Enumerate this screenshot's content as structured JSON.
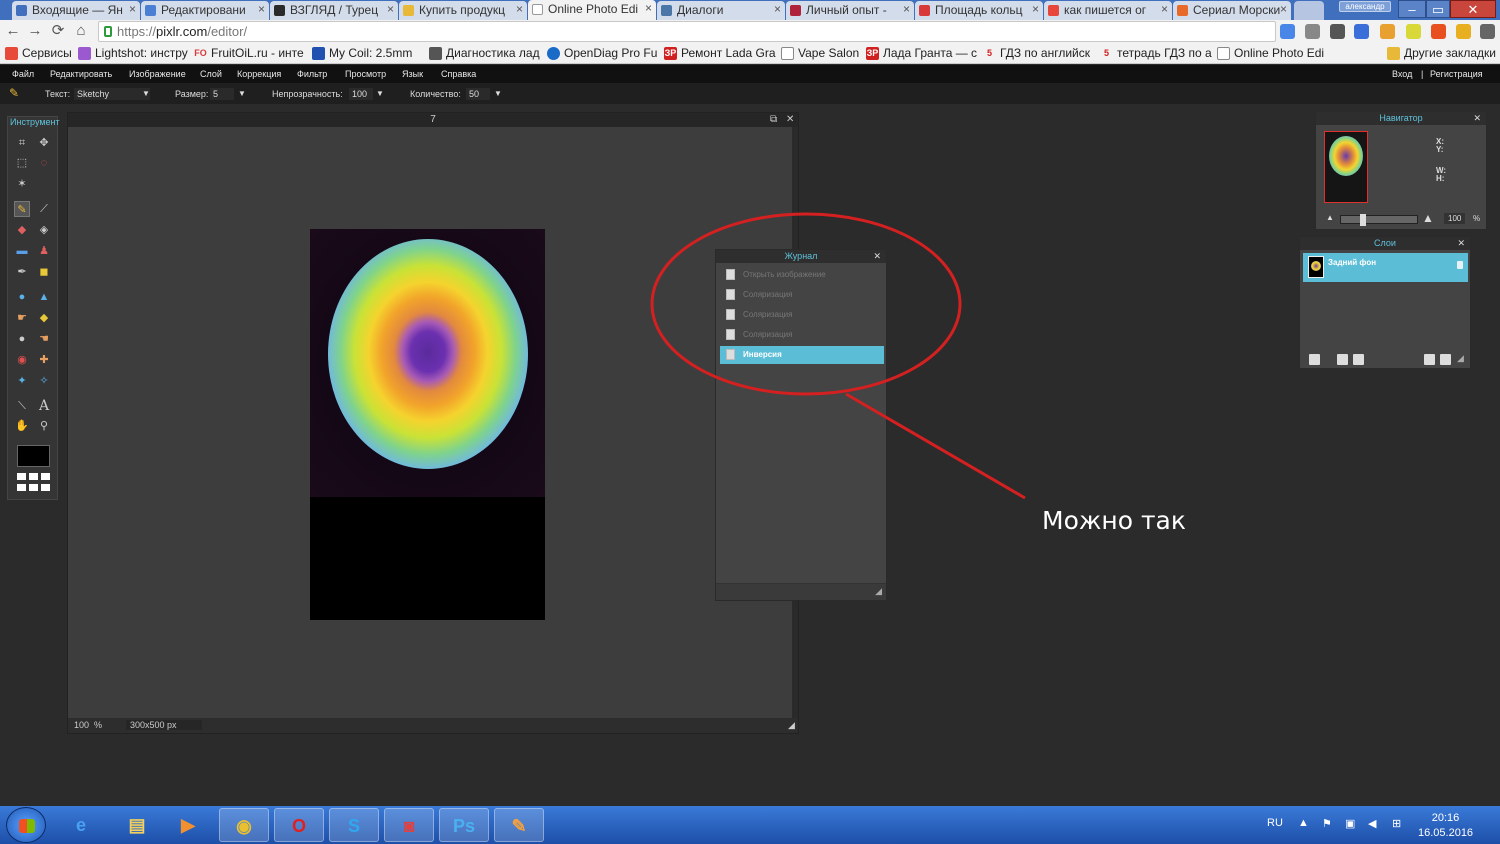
{
  "browser": {
    "tabs": [
      {
        "label": "Входящие — Ян",
        "color": "#3f6fbd"
      },
      {
        "label": "Редактировани",
        "color": "#4a7fd4"
      },
      {
        "label": "ВЗГЛЯД / Турец",
        "color": "#2a2a2a"
      },
      {
        "label": "Купить продукц",
        "color": "#e8b838"
      },
      {
        "label": "Online Photo Edi",
        "color": "#ffffff"
      },
      {
        "label": "Диалоги",
        "color": "#4a76a8"
      },
      {
        "label": "Личный опыт -",
        "color": "#b0223a"
      },
      {
        "label": "Площадь кольц",
        "color": "#d83a3a"
      },
      {
        "label": "как пишется ог",
        "color": "#e8463a"
      },
      {
        "label": "Сериал Морски",
        "color": "#e86a2a"
      }
    ],
    "active_tab": 4,
    "user": "александр",
    "url_prefix": "https://",
    "url_host": "pixlr.com",
    "url_path": "/editor/",
    "bookmarks": [
      {
        "label": "Сервисы",
        "icon": "apps-icon",
        "color": "#e84a3a"
      },
      {
        "label": "Lightshot: инстру",
        "icon": "feather-icon",
        "color": "#9b59d0"
      },
      {
        "label": "FruitOiL.ru - инте",
        "icon": "fo-icon",
        "color": "#d83a3a",
        "glyph": "FO"
      },
      {
        "label": "My Coil: 2.5mm",
        "icon": "coil-icon",
        "color": "#2050b0"
      },
      {
        "label": "Диагностика лад",
        "icon": "diag-icon",
        "color": "#555555"
      },
      {
        "label": "OpenDiag Pro Fu",
        "icon": "opendiag-icon",
        "color": "#1a6ac8"
      },
      {
        "label": "Ремонт Lada Gra",
        "icon": "zr-icon",
        "color": "#d02020",
        "glyph": "ЗР"
      },
      {
        "label": "Vape Salon",
        "icon": "page-icon",
        "color": "#888888"
      },
      {
        "label": "Лада Гранта — с",
        "icon": "zr-icon",
        "color": "#d02020",
        "glyph": "ЗР"
      },
      {
        "label": "ГДЗ по английск",
        "icon": "five-icon",
        "color": "#d02020",
        "glyph": "5"
      },
      {
        "label": "тетрадь ГДЗ по а",
        "icon": "five-icon",
        "color": "#d02020",
        "glyph": "5"
      },
      {
        "label": "Online Photo Edi",
        "icon": "page-icon",
        "color": "#888888"
      },
      {
        "label": "Другие закладки",
        "icon": "folder-icon",
        "color": "#e8b838"
      }
    ]
  },
  "editor": {
    "menu": [
      "Файл",
      "Редактировать",
      "Изображение",
      "Слой",
      "Коррекция",
      "Фильтр",
      "Просмотр",
      "Язык",
      "Справка"
    ],
    "auth": {
      "login": "Вход",
      "sep": "|",
      "register": "Регистрация"
    },
    "options": {
      "text_label": "Текст:",
      "text_value": "Sketchy",
      "size_label": "Размер:",
      "size_value": "5",
      "opacity_label": "Непрозрачность:",
      "opacity_value": "100",
      "count_label": "Количество:",
      "count_value": "50"
    },
    "toolbox_title": "Инструмент",
    "document": {
      "title": "7",
      "zoom": "100",
      "zoom_unit": "%",
      "dimensions": "300x500 px"
    },
    "journal": {
      "title": "Журнал",
      "items": [
        "Открыть изображение",
        "Соляризация",
        "Соляризация",
        "Соляризация",
        "Инверсия"
      ],
      "selected_index": 4
    },
    "navigator": {
      "title": "Навигатор",
      "x_label": "X:",
      "y_label": "Y:",
      "w_label": "W:",
      "h_label": "H:",
      "zoom": "100",
      "zoom_unit": "%"
    },
    "layers": {
      "title": "Слои",
      "items": [
        {
          "name": "Задний фон",
          "locked": true
        }
      ]
    }
  },
  "annotation": {
    "text": "Можно так",
    "color": "#d42020"
  },
  "taskbar": {
    "apps": [
      "windows-explorer-icon",
      "internet-explorer-icon",
      "file-explorer-icon",
      "media-player-icon",
      "chrome-icon",
      "opera-icon",
      "skype-icon",
      "screenshot-icon",
      "photoshop-icon",
      "paint-icon"
    ],
    "language": "RU",
    "time": "20:16",
    "date": "16.05.2016"
  }
}
